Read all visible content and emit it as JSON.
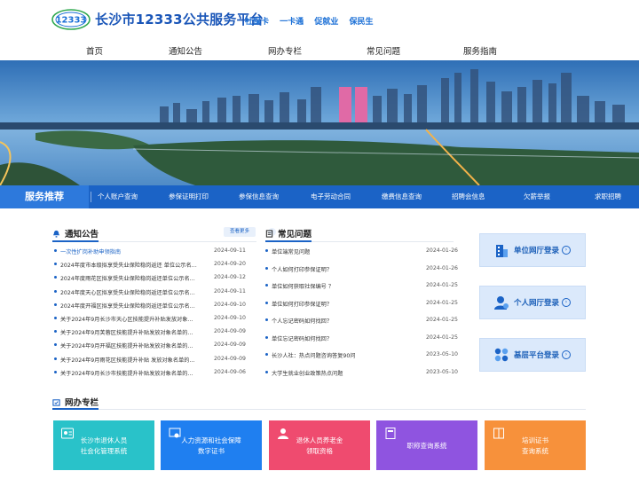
{
  "header": {
    "logo_text": "12333",
    "title": "长沙市12333公共服务平台",
    "slogans": [
      "社保卡",
      "一卡通",
      "促就业",
      "保民生"
    ]
  },
  "nav": [
    "首页",
    "通知公告",
    "网办专栏",
    "常见问题",
    "服务指南"
  ],
  "services": {
    "title": "服务推荐",
    "items": [
      "个人账户查询",
      "参保证明打印",
      "参保信息查询",
      "电子劳动合同",
      "缴费信息查询",
      "招聘会信息",
      "欠薪举报",
      "求职招聘"
    ]
  },
  "notices": {
    "title": "通知公告",
    "more_label": "查看更多",
    "items": [
      {
        "text": "一次性扩岗补助申领指南",
        "date": "2024-09-11",
        "highlight": true
      },
      {
        "text": "2024年度市本级拟享受失业保险稳岗返还 单位公示名…",
        "date": "2024-09-20",
        "highlight": false
      },
      {
        "text": "2024年度雨花区拟享受失业保险稳岗返还单位公示名…",
        "date": "2024-09-12",
        "highlight": false
      },
      {
        "text": "2024年度天心区拟享受失业保险稳岗返还单位公示名…",
        "date": "2024-09-11",
        "highlight": false
      },
      {
        "text": "2024年度开福区拟享受失业保险稳岗返还单位公示名…",
        "date": "2024-09-10",
        "highlight": false
      },
      {
        "text": "关于2024年9月长沙市天心区技能提升补贴发放对象…",
        "date": "2024-09-10",
        "highlight": false
      },
      {
        "text": "关于2024年9月芙蓉区技能提升补贴发放对象名单的…",
        "date": "2024-09-09",
        "highlight": false
      },
      {
        "text": "关于2024年9月开福区技能提升补贴发放对象名单的…",
        "date": "2024-09-09",
        "highlight": false
      },
      {
        "text": "关于2024年9月雨花区技能提升补贴 发放对象名单的…",
        "date": "2024-09-09",
        "highlight": false
      },
      {
        "text": "关于2024年9月长沙市技能提升补贴发放对象名单的…",
        "date": "2024-09-06",
        "highlight": false
      }
    ]
  },
  "faq": {
    "title": "常见问题",
    "items": [
      {
        "text": "单位端常见问题",
        "date": "2024-01-26"
      },
      {
        "text": "个人如何打印参保证明？",
        "date": "2024-01-26"
      },
      {
        "text": "单位如何获取社保编号 ？",
        "date": "2024-01-25"
      },
      {
        "text": "单位如何打印参保证明？",
        "date": "2024-01-25"
      },
      {
        "text": "个人忘记密码如何找回？",
        "date": "2024-01-25"
      },
      {
        "text": "单位忘记密码如何找回？",
        "date": "2024-01-25"
      },
      {
        "text": "长沙人社：热点问题咨询答复90问",
        "date": "2023-05-10"
      },
      {
        "text": "大学生就业创业政策热点问题",
        "date": "2023-05-10"
      }
    ]
  },
  "logins": [
    {
      "label": "单位网厅登录",
      "icon": "building-icon"
    },
    {
      "label": "个人网厅登录",
      "icon": "person-icon"
    },
    {
      "label": "基层平台登录",
      "icon": "grid-icon"
    }
  ],
  "online": {
    "title": "网办专栏",
    "cards": [
      {
        "lines": [
          "长沙市退休人员",
          "社会化管理系统"
        ],
        "color": "#29c2c9",
        "icon": "user-card-icon"
      },
      {
        "lines": [
          "人力资源和社会保障",
          "数字证书"
        ],
        "color": "#1f7ff0",
        "icon": "certificate-icon"
      },
      {
        "lines": [
          "退休人员养老金",
          "领取资格"
        ],
        "color": "#ef4b6f",
        "icon": "person-icon"
      },
      {
        "lines": [
          "职称查询系统"
        ],
        "color": "#8f54e0",
        "icon": "document-icon"
      },
      {
        "lines": [
          "培训证书",
          "查询系统"
        ],
        "color": "#f7913b",
        "icon": "book-icon"
      }
    ]
  },
  "colors": {
    "primary": "#1b63c6",
    "title": "#1a56b8",
    "slogan": "#1a6fd6",
    "login_bg": "#dbe9fb"
  }
}
